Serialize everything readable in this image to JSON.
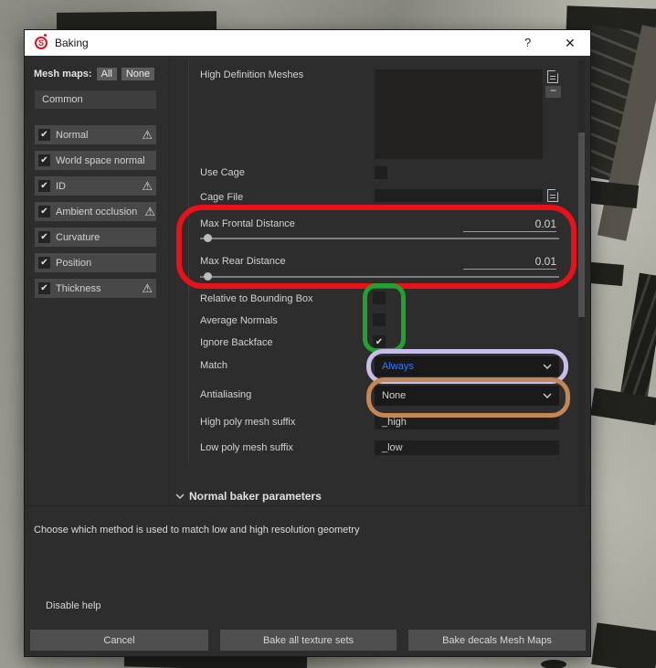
{
  "window": {
    "title": "Baking",
    "help_button": "?",
    "close_button": "✕"
  },
  "icons": {
    "check": "✔",
    "warning": "⚠",
    "minus": "−",
    "logo_letter": "S"
  },
  "sidebar": {
    "label": "Mesh maps:",
    "all_button": "All",
    "none_button": "None",
    "common_item": "Common",
    "items": [
      {
        "label": "Normal",
        "checked": true,
        "warning": true
      },
      {
        "label": "World space normal",
        "checked": true,
        "warning": false
      },
      {
        "label": "ID",
        "checked": true,
        "warning": true
      },
      {
        "label": "Ambient occlusion",
        "checked": true,
        "warning": true
      },
      {
        "label": "Curvature",
        "checked": true,
        "warning": false
      },
      {
        "label": "Position",
        "checked": true,
        "warning": false
      },
      {
        "label": "Thickness",
        "checked": true,
        "warning": true
      }
    ]
  },
  "params": {
    "high_definition_meshes": {
      "label": "High Definition Meshes",
      "value": ""
    },
    "use_cage": {
      "label": "Use Cage",
      "checked": false
    },
    "cage_file": {
      "label": "Cage File",
      "value": ""
    },
    "max_frontal_distance": {
      "label": "Max Frontal Distance",
      "value": "0.01"
    },
    "max_rear_distance": {
      "label": "Max Rear Distance",
      "value": "0.01"
    },
    "relative_to_bounding_box": {
      "label": "Relative to Bounding Box",
      "checked": false
    },
    "average_normals": {
      "label": "Average Normals",
      "checked": false
    },
    "ignore_backface": {
      "label": "Ignore Backface",
      "checked": true
    },
    "match": {
      "label": "Match",
      "value": "Always"
    },
    "antialiasing": {
      "label": "Antialiasing",
      "value": "None"
    },
    "high_poly_suffix": {
      "label": "High poly mesh suffix",
      "value": "_high"
    },
    "low_poly_suffix": {
      "label": "Low poly mesh suffix",
      "value": "_low"
    },
    "section_header": "Normal baker parameters"
  },
  "help": {
    "text": "Choose which method is used to match low and high resolution geometry",
    "disable_link": "Disable help"
  },
  "footer": {
    "cancel": "Cancel",
    "bake_all": "Bake all texture sets",
    "bake_decals": "Bake decals Mesh Maps"
  },
  "colors": {
    "annotation_red": "#e8121b",
    "annotation_green": "#23a130",
    "annotation_purple": "#c9bde9",
    "annotation_orange": "#c28754",
    "dropdown_value_blue": "#2e7bf6"
  }
}
